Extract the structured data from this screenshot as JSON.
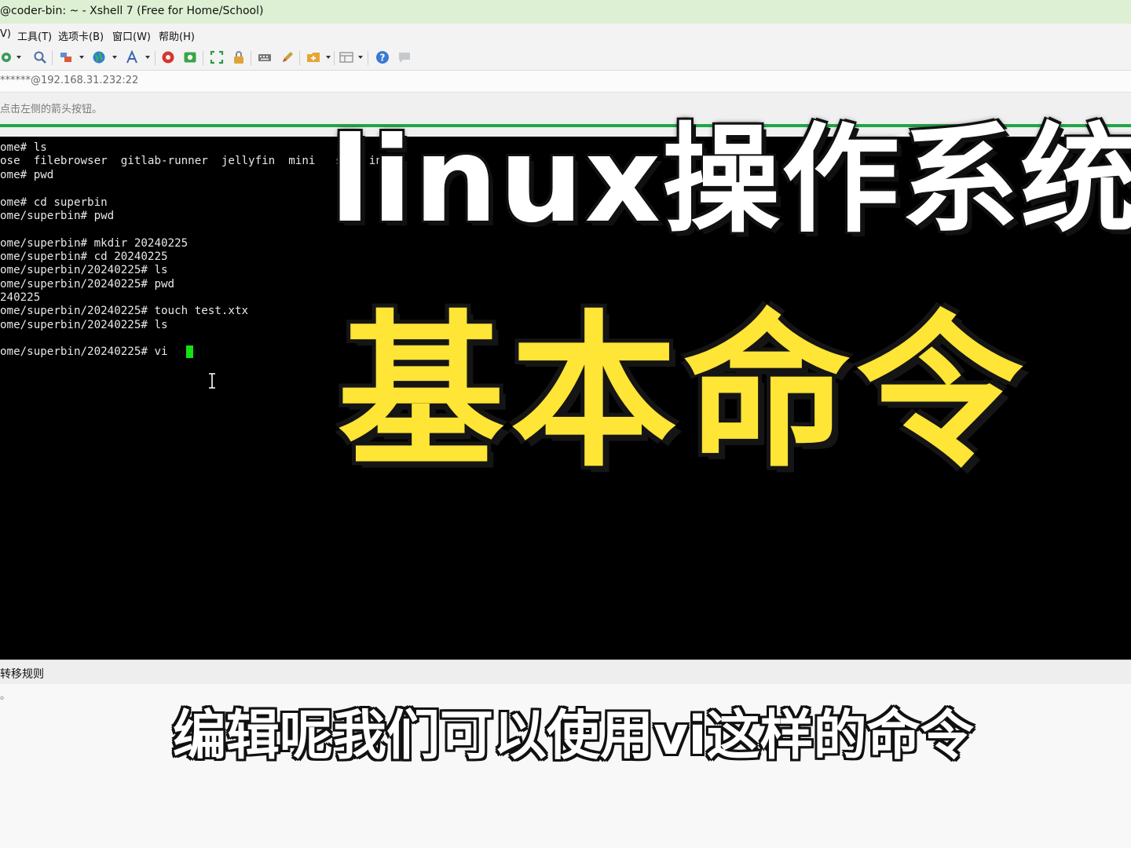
{
  "window": {
    "title": "@coder-bin: ~ - Xshell 7 (Free for Home/School)"
  },
  "menu": {
    "items": [
      {
        "label": "V)"
      },
      {
        "label": "工具(T)"
      },
      {
        "label": "选项卡(B)"
      },
      {
        "label": "窗口(W)"
      },
      {
        "label": "帮助(H)"
      }
    ]
  },
  "toolbar": {
    "icons": [
      "settings-icon",
      "search-icon",
      "sessions-icon",
      "globe-icon",
      "font-icon",
      "xftp-icon",
      "xmanager-icon",
      "fullscreen-icon",
      "lock-icon",
      "keyboard-icon",
      "pen-icon",
      "new-tab-icon",
      "layout-icon",
      "help-icon",
      "chat-icon"
    ]
  },
  "address": {
    "text": "******@192.168.31.232:22"
  },
  "hint": {
    "text": "点击左侧的箭头按钮。"
  },
  "terminal": {
    "lines": [
      "ome# ls",
      "ose  filebrowser  gitlab-runner  jellyfin  mini   su   in",
      "ome# pwd",
      "",
      "ome# cd superbin",
      "ome/superbin# pwd",
      "",
      "ome/superbin# mkdir 20240225",
      "ome/superbin# cd 20240225",
      "ome/superbin/20240225# ls",
      "ome/superbin/20240225# pwd",
      "240225",
      "ome/superbin/20240225# touch test.xtx",
      "ome/superbin/20240225# ls",
      "",
      "ome/superbin/20240225# vi "
    ]
  },
  "overlay": {
    "line1": "linux操作系统",
    "line2": "基本命令"
  },
  "status": {
    "text": "转移规则"
  },
  "bottom": {
    "mark": "。"
  },
  "subtitle": {
    "text": "编辑呢我们可以使用vi这样的命令"
  },
  "colors": {
    "title_bg": "#ddf0d3",
    "terminal_bg": "#000000",
    "cursor": "#14e014",
    "overlay_yellow": "#ffe535",
    "accent_green": "#22a64a"
  }
}
